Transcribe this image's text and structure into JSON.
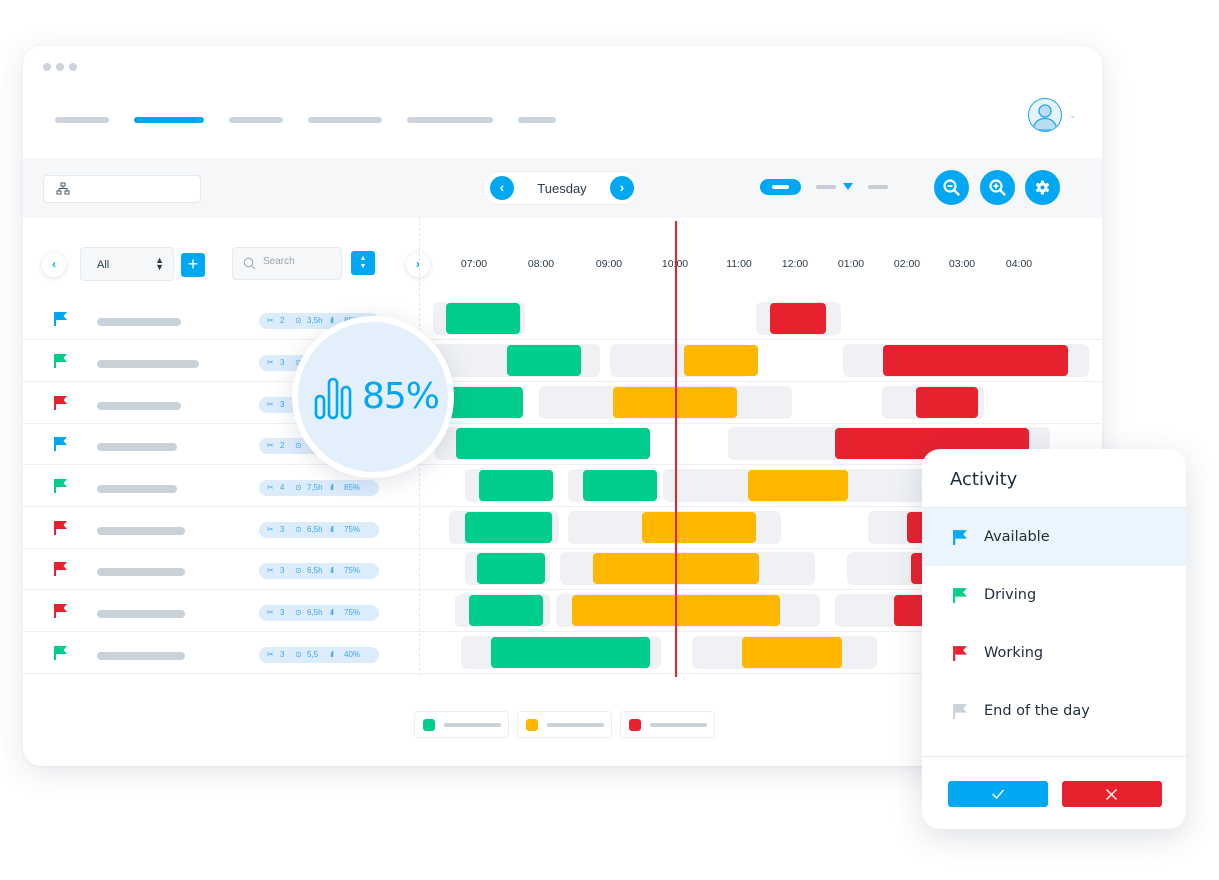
{
  "colors": {
    "accent": "#00a8f3",
    "driving": "#00cc8d",
    "waiting": "#ffb800",
    "working": "#e8212f",
    "available": "#00a8f3",
    "end_of_day": "#c9d1d9"
  },
  "header": {
    "nav_items": [
      {
        "label": "",
        "active": false
      },
      {
        "label": "",
        "active": true
      },
      {
        "label": "",
        "active": false
      },
      {
        "label": "",
        "active": false
      },
      {
        "label": "",
        "active": false
      },
      {
        "label": "",
        "active": false
      }
    ],
    "avatar_icon": "user-avatar-icon",
    "avatar_caret": "⌄"
  },
  "toolbar": {
    "org_icon": "hierarchy-icon",
    "prev_day": "‹",
    "day_label": "Tuesday",
    "next_day": "›",
    "zoom_out_icon": "zoom-out-icon",
    "zoom_in_icon": "zoom-in-icon",
    "settings_icon": "gear-icon"
  },
  "list_header": {
    "prev": "‹",
    "filter_value": "All",
    "filter_arrows": "▲▼",
    "add": "+",
    "search_placeholder": "Search",
    "sort_arrows": "▲▼",
    "next": "›"
  },
  "timeline": {
    "ticks": [
      "07:00",
      "08:00",
      "09:00",
      "10:00",
      "11:00",
      "12:00",
      "01:00",
      "02:00",
      "03:00",
      "04:00"
    ],
    "now": "10:00"
  },
  "rows": [
    {
      "status": "available",
      "tasks": "2",
      "hours": "3,5h",
      "score": "85%"
    },
    {
      "status": "driving",
      "tasks": "3",
      "hours": "",
      "score": ""
    },
    {
      "status": "working",
      "tasks": "3",
      "hours": "",
      "score": ""
    },
    {
      "status": "available",
      "tasks": "2",
      "hours": "",
      "score": ""
    },
    {
      "status": "driving",
      "tasks": "4",
      "hours": "7,5h",
      "score": "85%"
    },
    {
      "status": "working",
      "tasks": "3",
      "hours": "6,5h",
      "score": "75%"
    },
    {
      "status": "working",
      "tasks": "3",
      "hours": "6,5h",
      "score": "75%"
    },
    {
      "status": "working",
      "tasks": "3",
      "hours": "6,5h",
      "score": "75%"
    },
    {
      "status": "driving",
      "tasks": "3",
      "hours": "5,5",
      "score": "40%"
    }
  ],
  "kpi": {
    "icon": "bar-chart-icon",
    "value": "85%"
  },
  "legend": [
    {
      "color": "green",
      "label": ""
    },
    {
      "color": "yellow",
      "label": ""
    },
    {
      "color": "red",
      "label": ""
    }
  ],
  "activity_popup": {
    "title": "Activity",
    "items": [
      {
        "label": "Available",
        "status": "available",
        "selected": true
      },
      {
        "label": "Driving",
        "status": "driving",
        "selected": false
      },
      {
        "label": "Working",
        "status": "working",
        "selected": false
      },
      {
        "label": "End of the day",
        "status": "end_of_day",
        "selected": false
      }
    ],
    "confirm_icon": "check-icon",
    "cancel_icon": "close-icon"
  }
}
